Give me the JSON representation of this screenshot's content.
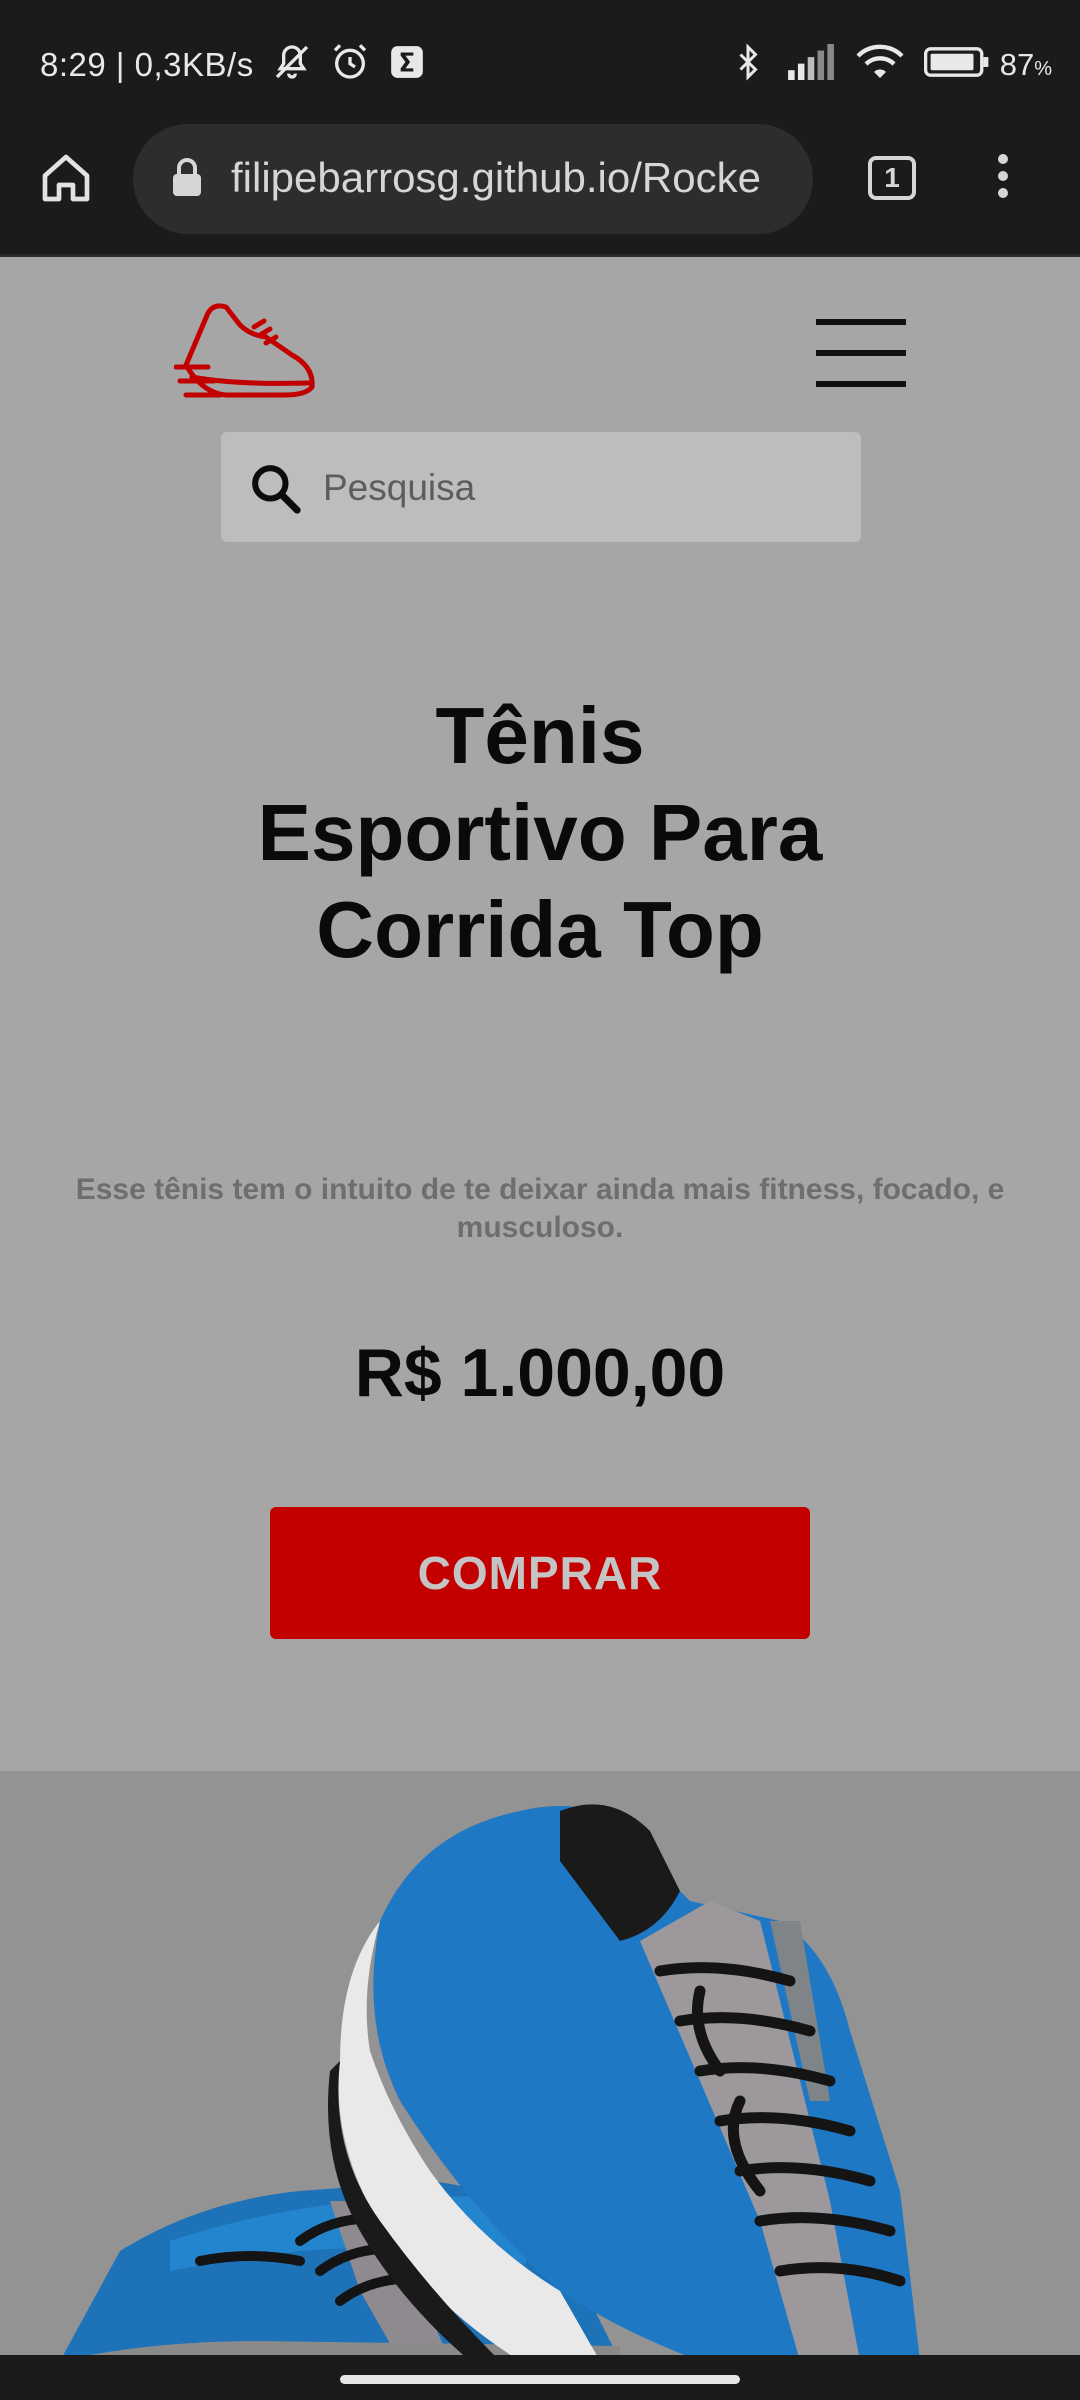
{
  "status_bar": {
    "time_speed": "8:29 | 0,3KB/s",
    "battery_percent": "87",
    "battery_unit": "%",
    "icons": [
      "mute-icon",
      "alarm-icon",
      "sigma-app-icon",
      "bluetooth-icon",
      "signal-icon",
      "wifi-icon",
      "battery-icon"
    ]
  },
  "browser": {
    "url": "filipebarrosg.github.io/Rocke",
    "tab_count": "1",
    "icons": [
      "home-icon",
      "lock-icon",
      "tabs-icon",
      "more-vert-icon"
    ]
  },
  "header": {
    "logo": "running-shoe-logo",
    "menu_icon": "hamburger-menu-icon",
    "search_placeholder": "Pesquisa"
  },
  "hero": {
    "title": "Tênis Esportivo Para Corrida Top",
    "description": "Esse tênis tem o intuito de te deixar ainda mais fitness, focado, e musculoso.",
    "price": "R$ 1.000,00",
    "buy_label": "COMPRAR"
  },
  "colors": {
    "accent": "#c30000",
    "page_background": "#a6a6a6",
    "product_background": "#939393",
    "shoe_blue": "#1d72b8"
  }
}
